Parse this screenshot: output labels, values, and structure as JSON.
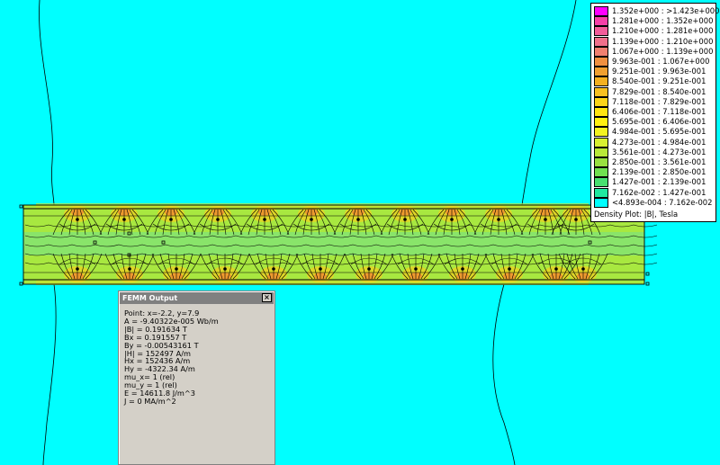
{
  "legend": {
    "entries": [
      {
        "label": "1.352e+000 : >1.423e+000",
        "color": "#ff00ff"
      },
      {
        "label": "1.281e+000 : 1.352e+000",
        "color": "#f640a8"
      },
      {
        "label": "1.210e+000 : 1.281e+000",
        "color": "#f25c9a"
      },
      {
        "label": "1.139e+000 : 1.210e+000",
        "color": "#f0708c"
      },
      {
        "label": "1.067e+000 : 1.139e+000",
        "color": "#f08070"
      },
      {
        "label": "9.963e-001 : 1.067e+000",
        "color": "#f09040"
      },
      {
        "label": "9.251e-001 : 9.963e-001",
        "color": "#f0a030"
      },
      {
        "label": "8.540e-001 : 9.251e-001",
        "color": "#f4b020"
      },
      {
        "label": "7.829e-001 : 8.540e-001",
        "color": "#f8c020"
      },
      {
        "label": "7.118e-001 : 7.829e-001",
        "color": "#fcd418"
      },
      {
        "label": "6.406e-001 : 7.118e-001",
        "color": "#ffe410"
      },
      {
        "label": "5.695e-001 : 6.406e-001",
        "color": "#fff010"
      },
      {
        "label": "4.984e-001 : 5.695e-001",
        "color": "#f4f420"
      },
      {
        "label": "4.273e-001 : 4.984e-001",
        "color": "#d8f030"
      },
      {
        "label": "3.561e-001 : 4.273e-001",
        "color": "#b8e838"
      },
      {
        "label": "2.850e-001 : 3.561e-001",
        "color": "#98e040"
      },
      {
        "label": "2.139e-001 : 2.850e-001",
        "color": "#70e050"
      },
      {
        "label": "1.427e-001 : 2.139e-001",
        "color": "#48e070"
      },
      {
        "label": "7.162e-002 : 1.427e-001",
        "color": "#20e8a0"
      },
      {
        "label": "<4.893e-004 : 7.162e-002",
        "color": "#00ffff"
      }
    ],
    "caption": "Density Plot: |B|, Tesla"
  },
  "femm_output": {
    "title": "FEMM Output",
    "close_glyph": "×",
    "lines": [
      "Point: x=-2.2, y=7.9",
      "A  = -9.40322e-005 Wb/m",
      "|B| = 0.191634 T",
      "Bx = 0.191557 T",
      "By = -0.00543161 T",
      "|H| = 152497 A/m",
      "Hx = 152436 A/m",
      "Hy = -4322.34 A/m",
      "mu_x= 1 (rel)",
      "mu_y = 1 (rel)",
      "E = 14611.8 J/m^3",
      "J = 0 MA/m^2"
    ]
  },
  "colors": {
    "background": "#00ffff",
    "band_fill": "#a8e840",
    "band_center": "#60e090",
    "hotspot": "#f0d020",
    "contour": "#000000"
  }
}
